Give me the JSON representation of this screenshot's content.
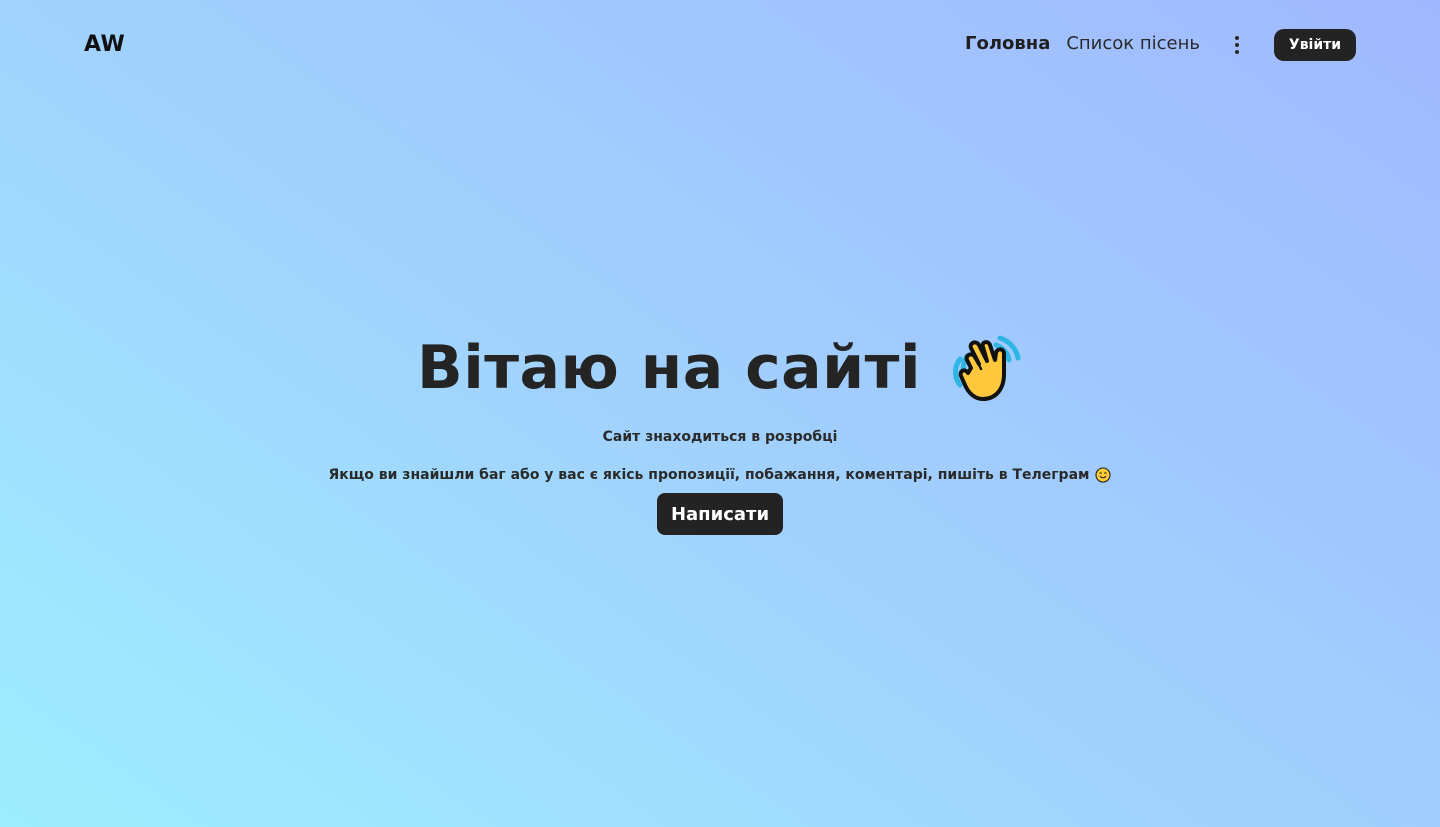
{
  "header": {
    "logo": "AW",
    "nav": [
      {
        "label": "Головна",
        "active": true
      },
      {
        "label": "Список пісень",
        "active": false
      }
    ],
    "menu_icon": "more-vertical-icon",
    "login_label": "Увійти"
  },
  "hero": {
    "title": "Вітаю на сайті",
    "title_icon": "waving-hand-icon",
    "subtitle": "Сайт знаходиться в розробці",
    "message": "Якщо ви знайшли баг або у вас є якісь пропозиції, побажання, коментарі, пишіть в Телеграм",
    "message_icon": "smiling-face-icon",
    "button_label": "Написати"
  },
  "colors": {
    "background_start": "#9eeefe",
    "background_end": "#a1b8ff",
    "button": "#232323",
    "text": "#222222"
  }
}
